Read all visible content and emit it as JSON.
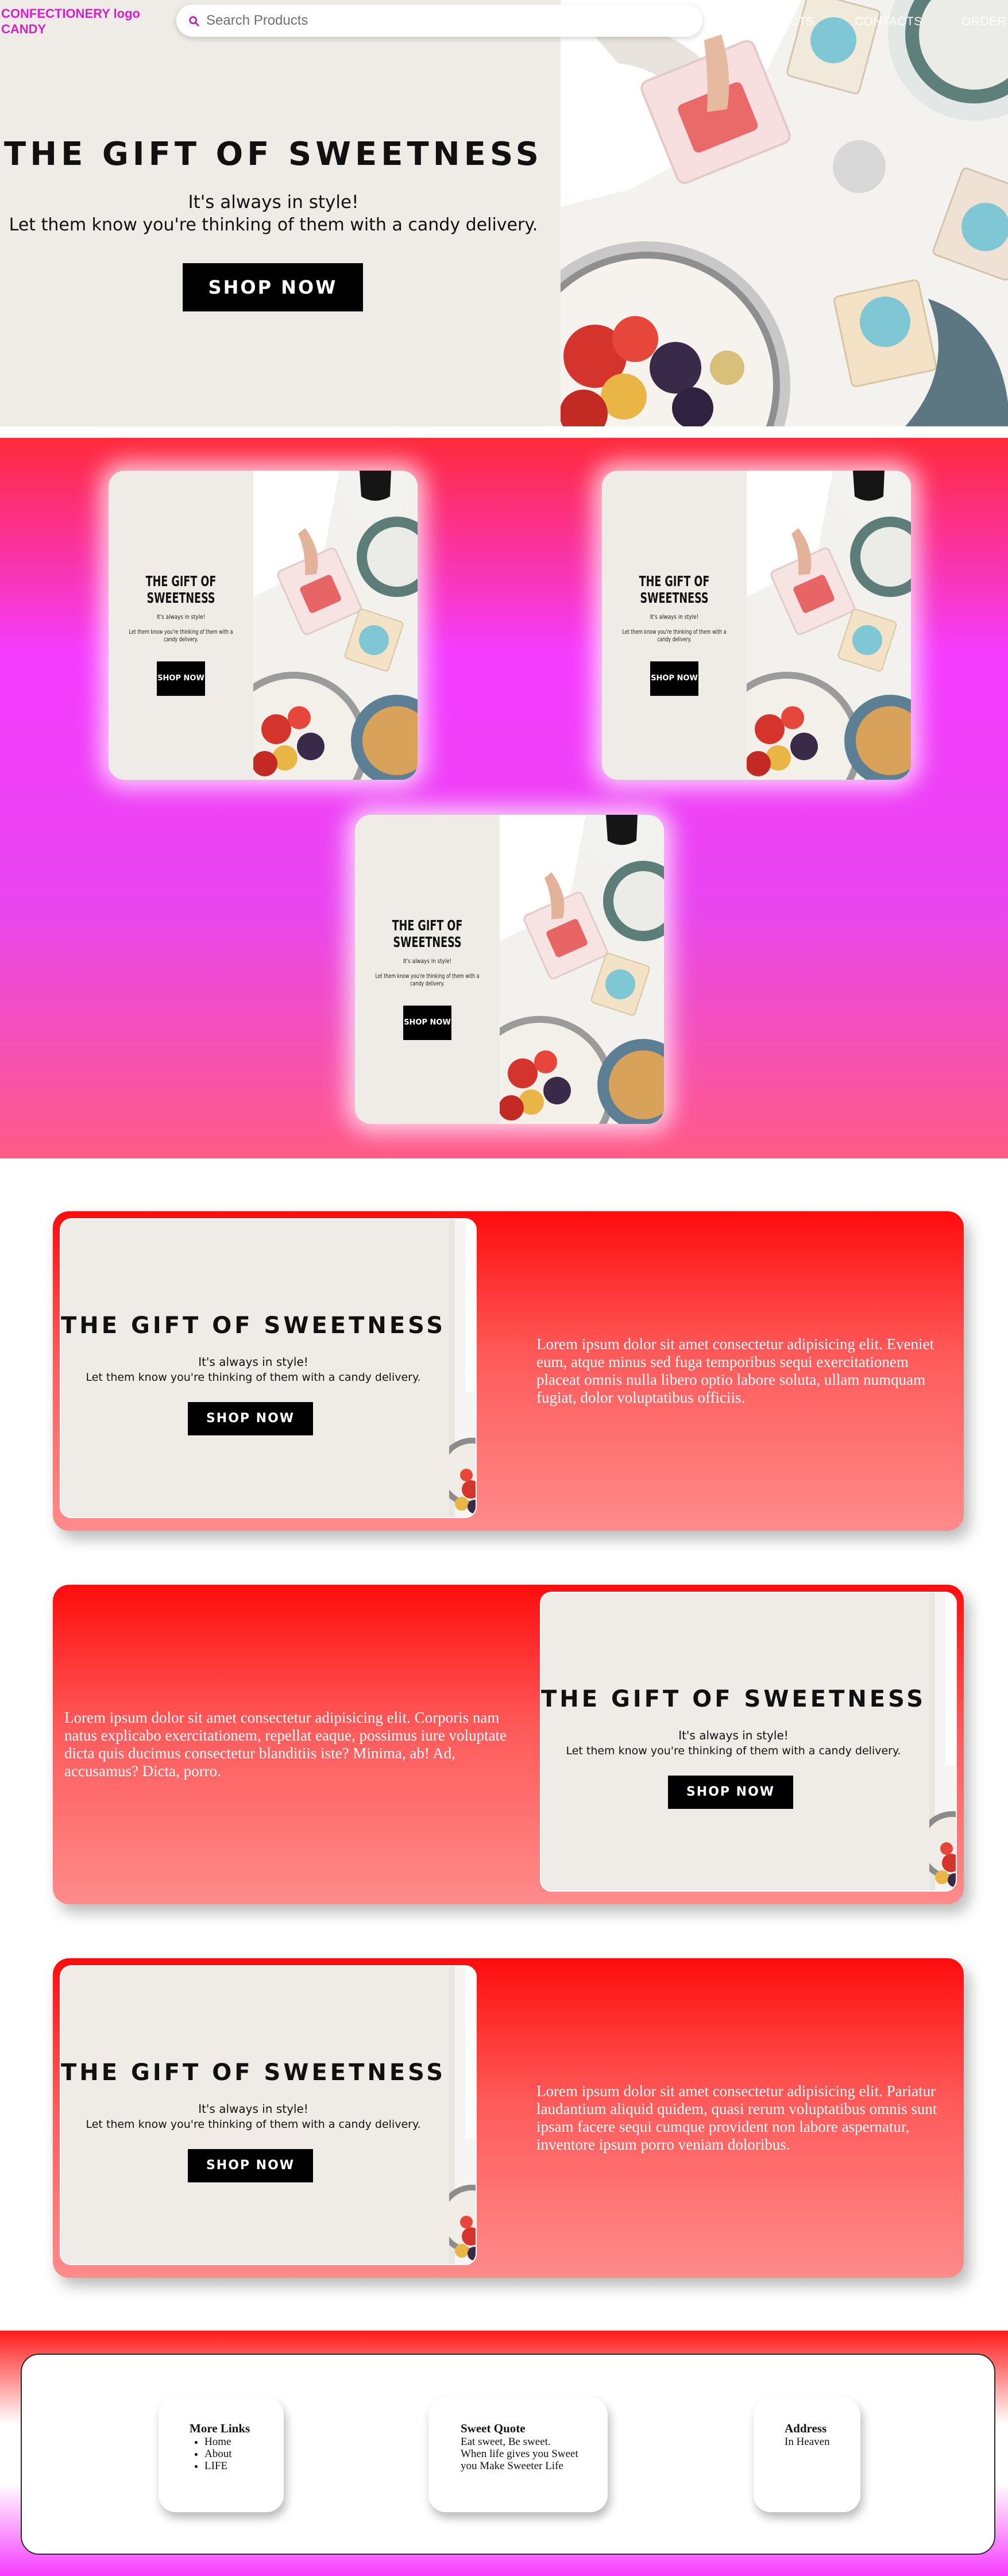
{
  "header": {
    "logo_line1": "CONFECTIONERY logo",
    "logo_line2": "CANDY",
    "search_placeholder": "Search Products",
    "nav": [
      "PRODUCTS",
      "CONTACTS",
      "ORDER"
    ]
  },
  "hero": {
    "title": "THE GIFT OF SWEETNESS",
    "subtitle1": "It's always in style!",
    "subtitle2": "Let them know you're thinking of them with a candy delivery.",
    "button": "SHOP NOW"
  },
  "grid_cards": [
    {
      "title": "THE GIFT OF SWEETNESS",
      "s1": "It's always in style!",
      "s2": "Let them know you're thinking of them with a candy delivery.",
      "button": "SHOP NOW"
    },
    {
      "title": "THE GIFT OF SWEETNESS",
      "s1": "It's always in style!",
      "s2": "Let them know you're thinking of them with a candy delivery.",
      "button": "SHOP NOW"
    },
    {
      "title": "THE GIFT OF SWEETNESS",
      "s1": "It's always in style!",
      "s2": "Let them know you're thinking of them with a candy delivery.",
      "button": "SHOP NOW"
    }
  ],
  "features": [
    {
      "title": "THE GIFT OF SWEETNESS",
      "s1": "It's always in style!",
      "s2": "Let them know you're thinking of them with a candy delivery.",
      "button": "SHOP NOW",
      "text": "Lorem ipsum dolor sit amet consectetur adipisicing elit. Eveniet eum, atque minus sed fuga temporibus sequi exercitationem placeat omnis nulla libero optio labore soluta, ullam numquam fugiat, dolor voluptatibus officiis."
    },
    {
      "title": "THE GIFT OF SWEETNESS",
      "s1": "It's always in style!",
      "s2": "Let them know you're thinking of them with a candy delivery.",
      "button": "SHOP NOW",
      "text": "Lorem ipsum dolor sit amet consectetur adipisicing elit. Corporis nam natus explicabo exercitationem, repellat eaque, possimus iure voluptate dicta quis ducimus consectetur blanditiis iste? Minima, ab! Ad, accusamus? Dicta, porro."
    },
    {
      "title": "THE GIFT OF SWEETNESS",
      "s1": "It's always in style!",
      "s2": "Let them know you're thinking of them with a candy delivery.",
      "button": "SHOP NOW",
      "text": "Lorem ipsum dolor sit amet consectetur adipisicing elit. Pariatur laudantium aliquid quidem, quasi rerum voluptatibus omnis sunt ipsam facere sequi cumque provident non labore aspernatur, inventore ipsum porro veniam doloribus."
    }
  ],
  "footer": {
    "links_title": "More Links",
    "links": [
      "Home",
      "About",
      "LIFE"
    ],
    "quote_title": "Sweet Quote",
    "quote_lines": [
      "Eat sweet, Be sweet.",
      "When life gives you Sweet",
      "you Make Sweeter Life"
    ],
    "address_title": "Address",
    "address": "In Heaven"
  },
  "colors": {
    "logo": "#d81fc8",
    "accent_red": "#ff0c0c",
    "accent_magenta": "#f53cff",
    "button": "#000000",
    "card_bg": "#efebe6"
  }
}
